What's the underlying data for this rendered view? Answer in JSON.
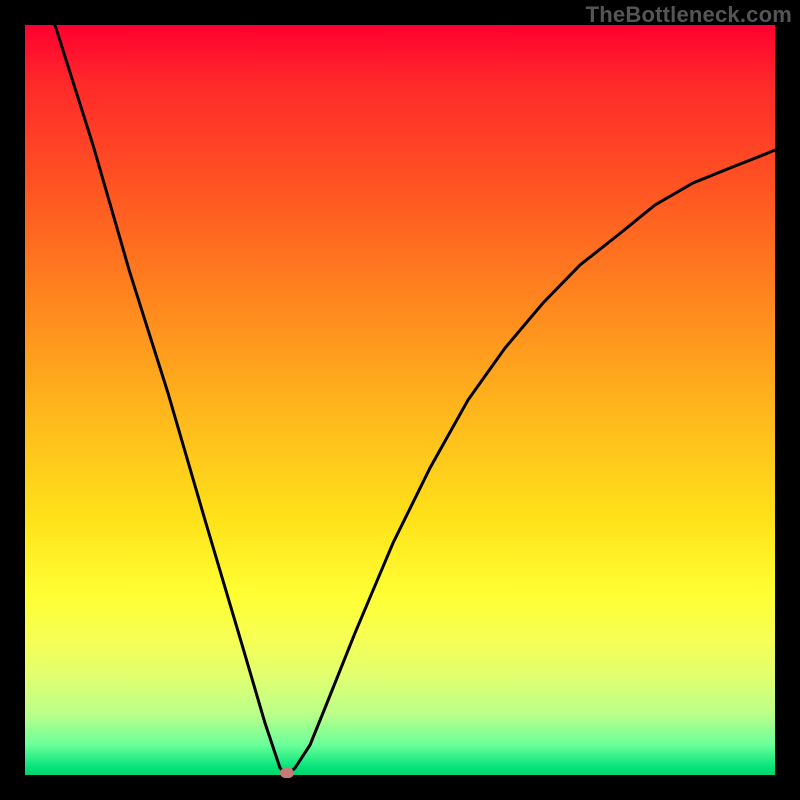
{
  "watermark": "TheBottleneck.com",
  "chart_data": {
    "type": "line",
    "title": "",
    "xlabel": "",
    "ylabel": "",
    "xlim": [
      0,
      100
    ],
    "ylim": [
      0,
      100
    ],
    "grid": false,
    "background_gradient": {
      "top_color": "#ff0030",
      "bottom_color": "#00d36c",
      "meaning": "red = high bottleneck, green = no bottleneck"
    },
    "series": [
      {
        "name": "bottleneck-curve",
        "x": [
          0,
          5,
          10,
          15,
          20,
          25,
          28,
          30,
          31,
          32,
          34,
          36,
          40,
          45,
          50,
          55,
          60,
          65,
          70,
          75,
          80,
          85,
          90,
          95,
          100
        ],
        "y": [
          100,
          84,
          67,
          51,
          34,
          17,
          7,
          1,
          0,
          1,
          4,
          9,
          19,
          31,
          41,
          50,
          57,
          63,
          68,
          72,
          76,
          79,
          81,
          83,
          85
        ]
      }
    ],
    "annotations": [
      {
        "name": "optimal-point",
        "x": 31,
        "y": 0,
        "marker_color": "#c57a78"
      }
    ]
  }
}
